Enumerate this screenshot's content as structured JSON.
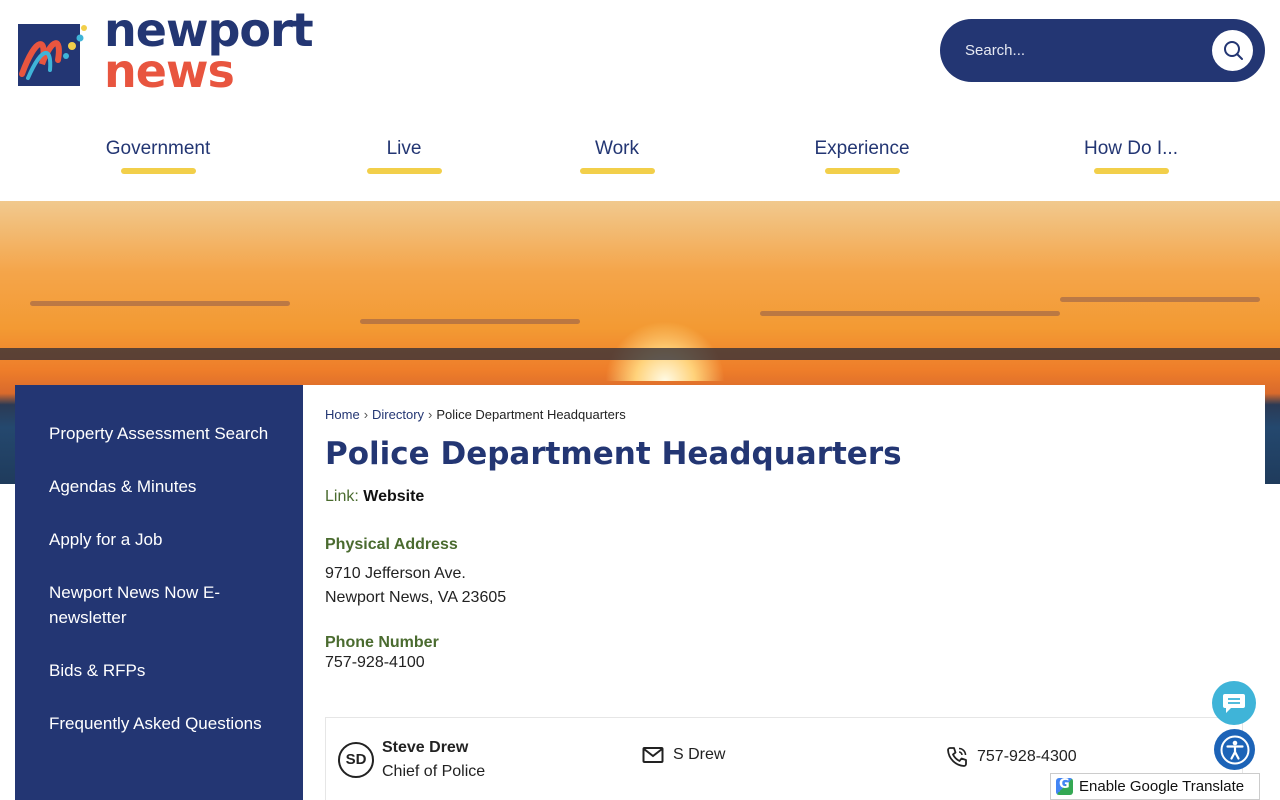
{
  "header": {
    "logo": {
      "line1": "newport",
      "line2": "news"
    },
    "search": {
      "placeholder": "Search..."
    },
    "nav": [
      {
        "label": "Government"
      },
      {
        "label": "Live"
      },
      {
        "label": "Work"
      },
      {
        "label": "Experience"
      },
      {
        "label": "How Do I..."
      }
    ]
  },
  "sidebar": {
    "items": [
      {
        "label": "Property Assessment Search"
      },
      {
        "label": "Agendas & Minutes"
      },
      {
        "label": "Apply for a Job"
      },
      {
        "label": "Newport News Now E-newsletter"
      },
      {
        "label": "Bids & RFPs"
      },
      {
        "label": "Frequently Asked Questions"
      }
    ]
  },
  "breadcrumb": {
    "home": "Home",
    "sep1": "›",
    "directory": "Directory",
    "sep2": "›",
    "current": "Police Department Headquarters"
  },
  "main": {
    "title": "Police Department Headquarters",
    "link_label": "Link:",
    "link_text": "Website",
    "address_label": "Physical Address",
    "address_line1": "9710 Jefferson Ave.",
    "address_line2": "Newport News, VA 23605",
    "phone_label": "Phone Number",
    "phone": "757-928-4100"
  },
  "contact": {
    "initials": "SD",
    "name": "Steve Drew",
    "title": "Chief of Police",
    "email_label": "S Drew",
    "phone": "757-928-4300"
  },
  "floating": {
    "translate_label": "Enable Google Translate"
  },
  "colors": {
    "brand_navy": "#233673",
    "brand_coral": "#e8553f",
    "nav_underline": "#f2cf4a",
    "label_green": "#4a6b2f",
    "chat_blue": "#3fb4d8",
    "a11y_blue": "#1c63b7"
  }
}
